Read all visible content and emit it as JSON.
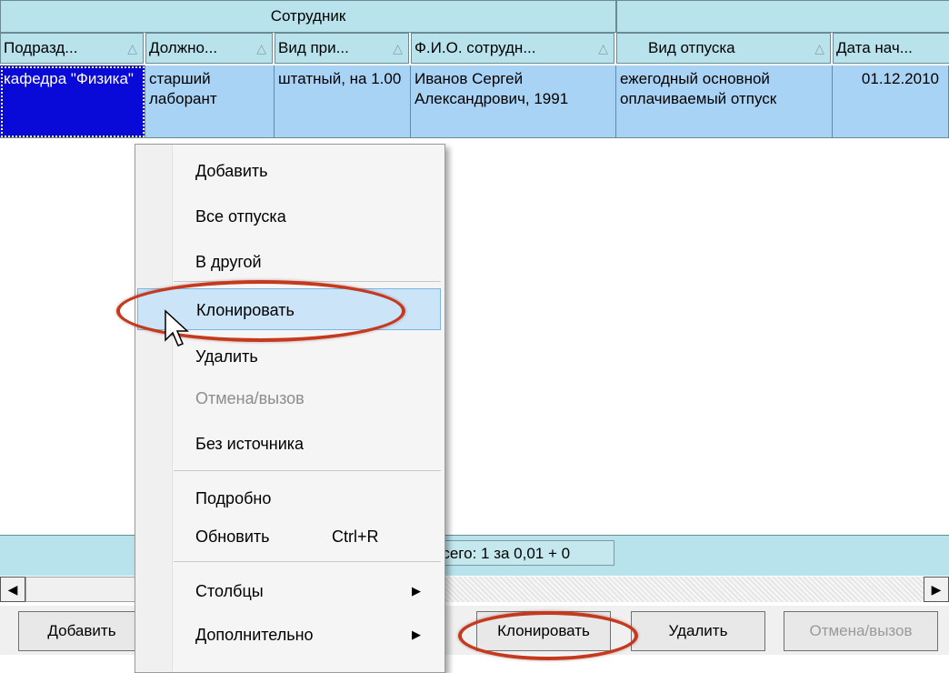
{
  "grid": {
    "group_header": "Сотрудник",
    "columns": [
      {
        "label": "Подразд...",
        "sort": "△"
      },
      {
        "label": "Должно...",
        "sort": "△"
      },
      {
        "label": "Вид при...",
        "sort": "△"
      },
      {
        "label": "Ф.И.О. сотрудн...",
        "sort": "△"
      },
      {
        "label": "Вид отпуска",
        "sort": "△"
      },
      {
        "label": "Дата нач...",
        "sort": ""
      }
    ],
    "row": {
      "department": "кафедра \"Физика\"",
      "position": "старший лаборант",
      "employment": "штатный, на 1.00",
      "employee": "Иванов Сергей Александрович, 1991",
      "leave_type": "ежегодный основной оплачиваемый отпуск",
      "start_date": "01.12.2010"
    }
  },
  "footer": {
    "total": "Всего: 1 за 0,01 + 0"
  },
  "toolbar": {
    "add": "Добавить",
    "clone": "Клонировать",
    "delete": "Удалить",
    "cancel": "Отмена/вызов"
  },
  "context_menu": {
    "add": "Добавить",
    "all_leaves": "Все отпуска",
    "to_other": "В другой",
    "clone": "Клонировать",
    "delete": "Удалить",
    "cancel_recall": "Отмена/вызов",
    "no_source": "Без источника",
    "details": "Подробно",
    "refresh": "Обновить",
    "refresh_shortcut": "Ctrl+R",
    "columns": "Столбцы",
    "additional": "Дополнительно"
  },
  "colors": {
    "header_bg": "#b9e3ec",
    "row_bg": "#a9d3f5",
    "selected_bg": "#0a0ad8",
    "menu_hover": "#cce4f7",
    "annotation": "#c43a1e"
  },
  "icons": [
    "scroll-left-icon",
    "scroll-right-icon",
    "submenu-arrow-icon",
    "mouse-cursor-icon"
  ]
}
